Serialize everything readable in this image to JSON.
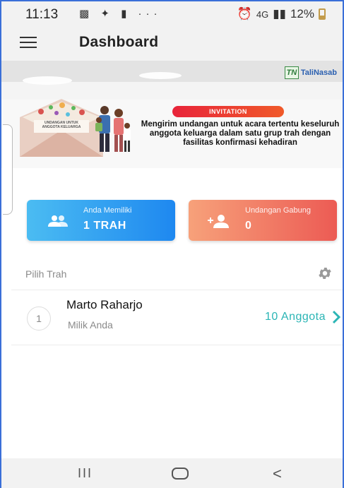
{
  "status_bar": {
    "time": "11:13",
    "left_icons": "▩ ✦ ▮ ···",
    "network": "4G",
    "battery": "12%"
  },
  "app_bar": {
    "title": "Dashboard"
  },
  "banner": {
    "logo_text": "TaliNasab",
    "logo_mark": "TN",
    "pill": "INVITATION",
    "envelope_text": "UNDANGAN UNTUK ANGGOTA KELUARGA",
    "description": "Mengirim undangan untuk acara  tertentu keseluruh anggota keluarga dalam satu grup trah dengan fasilitas konfirmasi kehadiran"
  },
  "cards": {
    "owned": {
      "caption": "Anda Memiliki",
      "value": "1 TRAH"
    },
    "invites": {
      "caption": "Undangan Gabung",
      "value": "0"
    }
  },
  "section": {
    "label": "Pilih Trah"
  },
  "trah_list": [
    {
      "number": "1",
      "name": "Marto Raharjo",
      "subtitle": "Milik Anda",
      "count": "10 Anggota"
    }
  ],
  "nav": {
    "recent": "III",
    "back": "<"
  },
  "colors": {
    "card_blue_start": "#4bbcf2",
    "card_blue_end": "#1e88f0",
    "card_red_start": "#f7a17a",
    "card_red_end": "#ec5b54",
    "count_teal": "#2bb5b5",
    "invitation_red": "#e8243a"
  }
}
